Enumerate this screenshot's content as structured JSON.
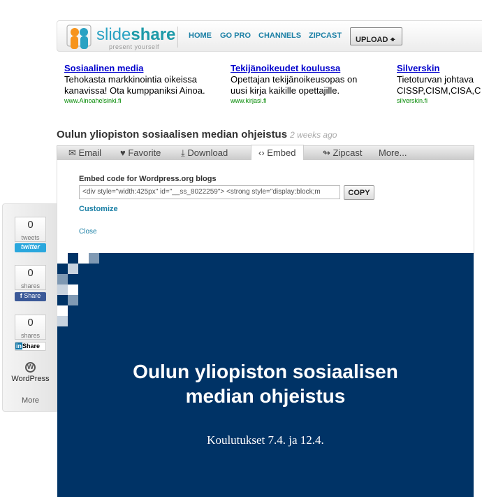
{
  "header": {
    "logo_text_a": "slide",
    "logo_text_b": "share",
    "logo_tagline": "present yourself",
    "nav": [
      "HOME",
      "GO PRO",
      "CHANNELS",
      "ZIPCAST"
    ],
    "upload_label": "UPLOAD"
  },
  "ads": [
    {
      "title": "Sosiaalinen media",
      "line1": "Tehokasta markkinointia oikeissa",
      "line2": "kanavissa! Ota kumppaniksi Ainoa.",
      "url": "www.Ainoahelsinki.fi"
    },
    {
      "title": "Tekijänoikeudet koulussa",
      "line1": "Opettajan tekijänoikeusopas on",
      "line2": "uusi kirja kaikille opettajille.",
      "url": "www.kirjasi.fi"
    },
    {
      "title": "Silverskin",
      "line1": "Tietoturvan johtava",
      "line2": "CISSP,CISM,CISA,C",
      "url": "silverskin.fi"
    }
  ],
  "presentation": {
    "title": "Oulun yliopiston sosiaalisen median ohjeistus",
    "age": "2 weeks ago"
  },
  "tabs": [
    {
      "label": "Email",
      "icon": "envelope-icon"
    },
    {
      "label": "Favorite",
      "icon": "heart-icon"
    },
    {
      "label": "Download",
      "icon": "download-icon"
    },
    {
      "label": "Embed",
      "icon": "code-icon",
      "active": true
    },
    {
      "label": "Zipcast",
      "icon": "zipcast-icon"
    },
    {
      "label": "More..."
    }
  ],
  "embed": {
    "label": "Embed code for Wordpress.org blogs",
    "code": "<div style=\"width:425px\" id=\"__ss_8022259\"> <strong style=\"display:block;m",
    "copy_label": "COPY",
    "customize": "Customize",
    "close": "Close"
  },
  "social": {
    "twitter": {
      "count": "0",
      "unit": "tweets",
      "label": "twitter"
    },
    "facebook": {
      "count": "0",
      "unit": "shares",
      "label": "Share"
    },
    "linkedin": {
      "count": "0",
      "unit": "shares",
      "label": "Share"
    },
    "wordpress": "WordPress",
    "more": "More"
  },
  "slide": {
    "title_line1": "Oulun yliopiston sosiaalisen",
    "title_line2": "median ohjeistus",
    "subtitle": "Koulutukset 7.4. ja 12.4.",
    "background": "#003366"
  }
}
